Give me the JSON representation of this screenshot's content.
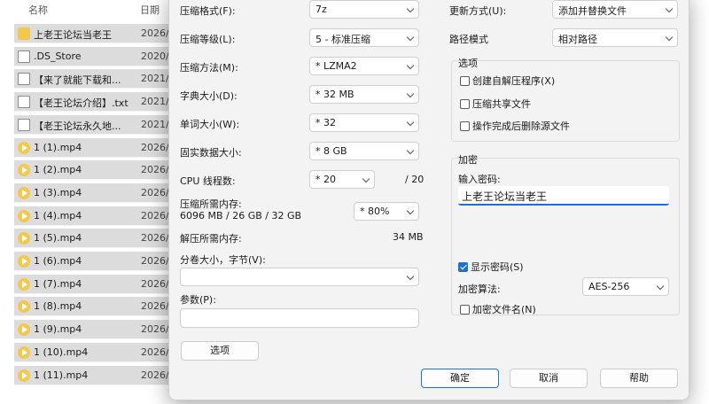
{
  "explorer": {
    "headers": {
      "name": "名称",
      "date": "日期"
    },
    "rows": [
      {
        "icon": "folder-icon",
        "name": "上老王论坛当老王",
        "date": "2026/"
      },
      {
        "icon": "file-icon",
        "name": ".DS_Store",
        "date": "2020/"
      },
      {
        "icon": "file-icon",
        "name": "【来了就能下载和...",
        "date": "2021/"
      },
      {
        "icon": "file-icon",
        "name": "【老王论坛介绍】.txt",
        "date": "2021/"
      },
      {
        "icon": "file-icon",
        "name": "【老王论坛永久地...",
        "date": "2021/"
      },
      {
        "icon": "video-icon",
        "name": "1 (1).mp4",
        "date": "2026/"
      },
      {
        "icon": "video-icon",
        "name": "1 (2).mp4",
        "date": "2026/"
      },
      {
        "icon": "video-icon",
        "name": "1 (3).mp4",
        "date": "2026/"
      },
      {
        "icon": "video-icon",
        "name": "1 (4).mp4",
        "date": "2026/"
      },
      {
        "icon": "video-icon",
        "name": "1 (5).mp4",
        "date": "2026/"
      },
      {
        "icon": "video-icon",
        "name": "1 (6).mp4",
        "date": "2026/"
      },
      {
        "icon": "video-icon",
        "name": "1 (7).mp4",
        "date": "2026/"
      },
      {
        "icon": "video-icon",
        "name": "1 (8).mp4",
        "date": "2026/"
      },
      {
        "icon": "video-icon",
        "name": "1 (9).mp4",
        "date": "2026/"
      },
      {
        "icon": "video-icon",
        "name": "1 (10).mp4",
        "date": "2026/"
      },
      {
        "icon": "video-icon",
        "name": "1 (11).mp4",
        "date": "2026/"
      }
    ]
  },
  "dialog": {
    "left": {
      "format_label": "压缩格式(F):",
      "format_value": "7z",
      "level_label": "压缩等级(L):",
      "level_value": "5 - 标准压缩",
      "method_label": "压缩方法(M):",
      "method_value": "* LZMA2",
      "dict_label": "字典大小(D):",
      "dict_value": "* 32 MB",
      "word_label": "单词大小(W):",
      "word_value": "* 32",
      "solid_label": "固实数据大小:",
      "solid_value": "* 8 GB",
      "cpu_label": "CPU 线程数:",
      "cpu_value": "* 20",
      "cpu_total": "/ 20",
      "mem_label": "压缩所需内存:",
      "mem_detail": "6096 MB / 26 GB / 32 GB",
      "mem_value": "* 80%",
      "decomp_label": "解压所需内存:",
      "decomp_value": "34 MB",
      "split_label": "分卷大小，字节(V):",
      "params_label": "参数(P):",
      "options_button": "选项"
    },
    "right": {
      "update_label": "更新方式(U):",
      "update_value": "添加并替换文件",
      "path_label": "路径模式",
      "path_value": "相对路径",
      "options_group": "选项",
      "opt_sfx": "创建自解压程序(X)",
      "opt_shared": "压缩共享文件",
      "opt_delete": "操作完成后删除源文件",
      "enc_group": "加密",
      "pwd_label": "输入密码:",
      "pwd_value": "上老王论坛当老王",
      "show_pwd": "显示密码(S)",
      "algo_label": "加密算法:",
      "algo_value": "AES-256",
      "enc_names": "加密文件名(N)"
    },
    "buttons": {
      "ok": "确定",
      "cancel": "取消",
      "help": "帮助"
    }
  }
}
